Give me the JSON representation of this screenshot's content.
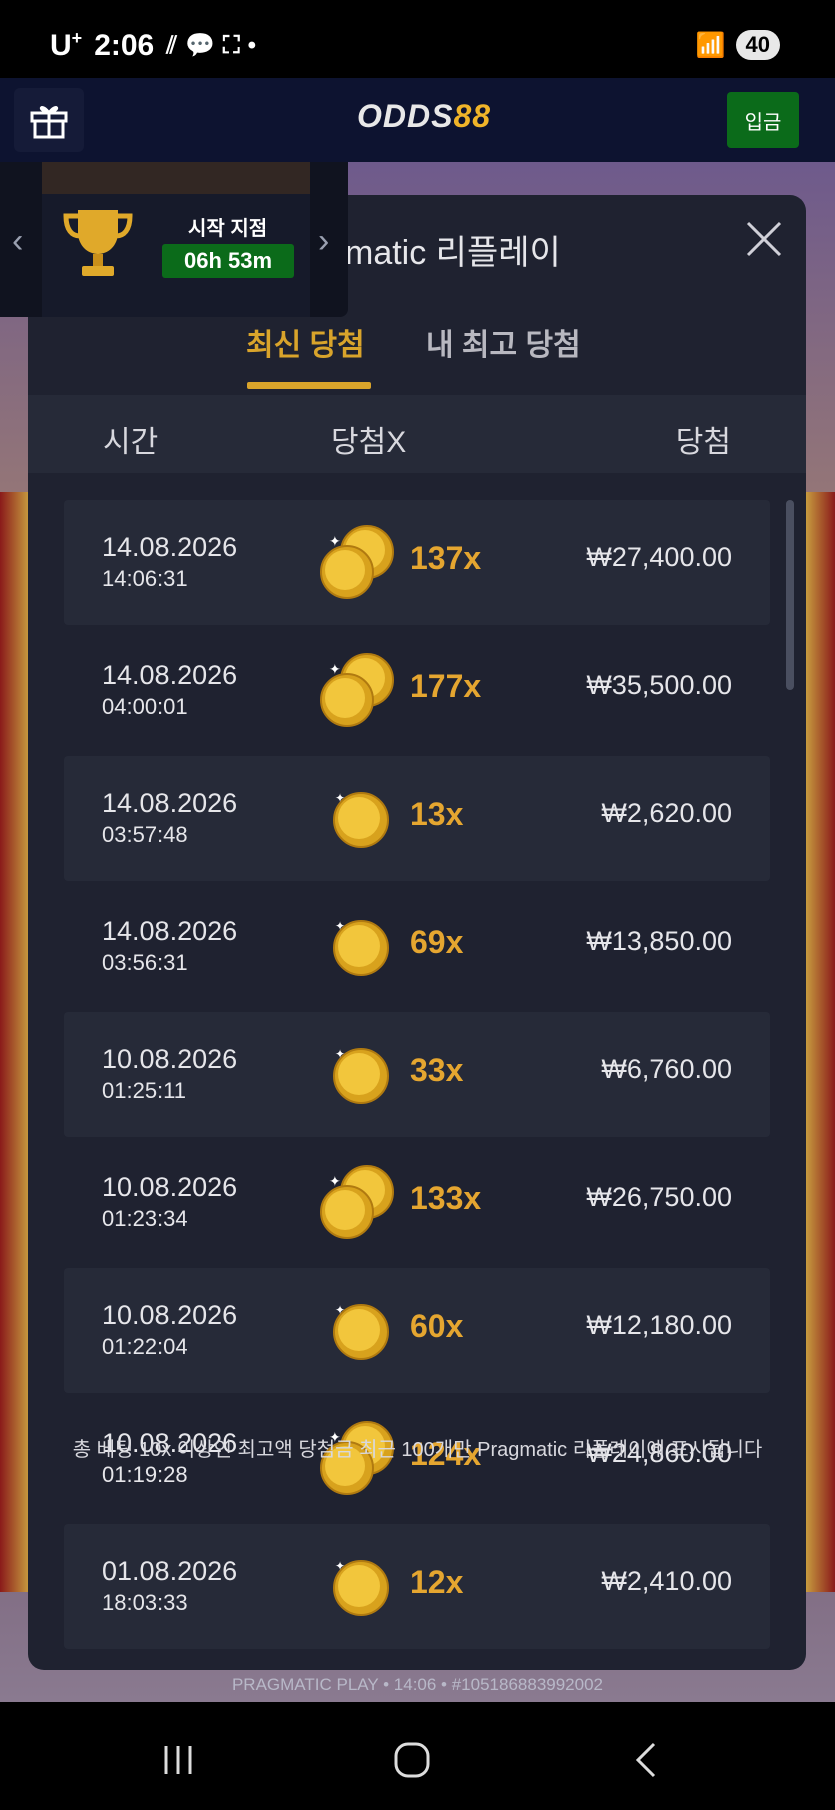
{
  "status_bar": {
    "carrier": "U",
    "carrier_sup": "+",
    "time": "2:06",
    "battery": "40"
  },
  "header": {
    "logo_part1": "ODDS",
    "logo_part2": "88",
    "deposit_label": "입금"
  },
  "tournament": {
    "label": "시작 지점",
    "timer": "06h 53m"
  },
  "modal": {
    "title": "Pragmatic 리플레이",
    "tabs": [
      {
        "label": "최신 당첨",
        "active": true
      },
      {
        "label": "내 최고 당첨",
        "active": false
      }
    ],
    "columns": {
      "time": "시간",
      "multiplier": "당첨X",
      "win": "당첨"
    },
    "rows": [
      {
        "date": "14.08.2026",
        "time": "14:06:31",
        "multiplier": "137x",
        "win": "₩27,400.00",
        "coins": "double"
      },
      {
        "date": "14.08.2026",
        "time": "04:00:01",
        "multiplier": "177x",
        "win": "₩35,500.00",
        "coins": "double"
      },
      {
        "date": "14.08.2026",
        "time": "03:57:48",
        "multiplier": "13x",
        "win": "₩2,620.00",
        "coins": "single"
      },
      {
        "date": "14.08.2026",
        "time": "03:56:31",
        "multiplier": "69x",
        "win": "₩13,850.00",
        "coins": "single"
      },
      {
        "date": "10.08.2026",
        "time": "01:25:11",
        "multiplier": "33x",
        "win": "₩6,760.00",
        "coins": "single"
      },
      {
        "date": "10.08.2026",
        "time": "01:23:34",
        "multiplier": "133x",
        "win": "₩26,750.00",
        "coins": "double"
      },
      {
        "date": "10.08.2026",
        "time": "01:22:04",
        "multiplier": "60x",
        "win": "₩12,180.00",
        "coins": "single"
      },
      {
        "date": "10.08.2026",
        "time": "01:19:28",
        "multiplier": "124x",
        "win": "₩24,860.00",
        "coins": "double"
      },
      {
        "date": "01.08.2026",
        "time": "18:03:33",
        "multiplier": "12x",
        "win": "₩2,410.00",
        "coins": "single"
      }
    ],
    "footer_note": "총 베팅 10x 이상인 최고액 당첨금 최근 100개만 Pragmatic 리플레이에 표시됩니다"
  },
  "game_info": "PRAGMATIC PLAY • 14:06 • #105186883992002",
  "colors": {
    "accent_gold": "#d9a42b",
    "deposit_green": "#0b6b1a",
    "modal_bg": "#1f2230"
  }
}
